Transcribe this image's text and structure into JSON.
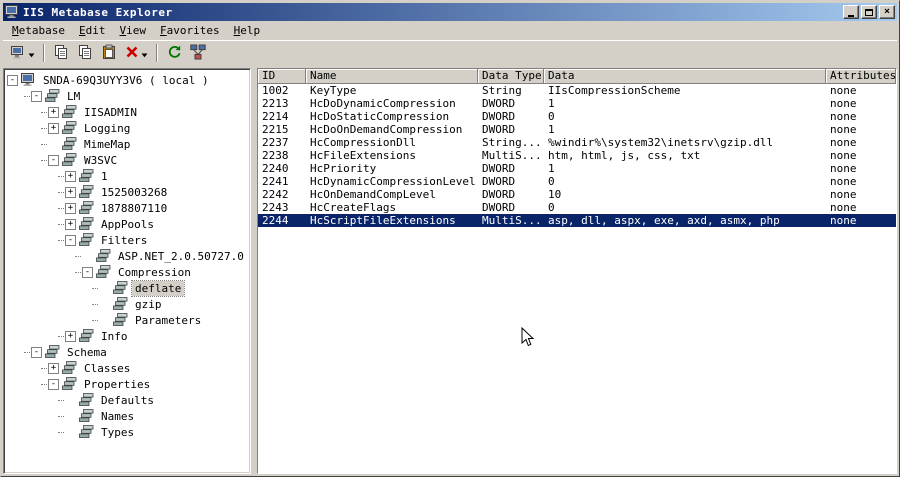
{
  "window": {
    "title": "IIS Metabase Explorer"
  },
  "menu": {
    "items": [
      {
        "label": "Metabase"
      },
      {
        "label": "Edit"
      },
      {
        "label": "View"
      },
      {
        "label": "Favorites"
      },
      {
        "label": "Help"
      }
    ]
  },
  "toolbar": {
    "buttons": [
      {
        "name": "connect-button",
        "icon": "computer-icon",
        "dropdown": true
      },
      {
        "separator": true
      },
      {
        "name": "copy-button",
        "icon": "copy-icon"
      },
      {
        "name": "duplicate-button",
        "icon": "copy-icon"
      },
      {
        "name": "paste-button",
        "icon": "paste-icon"
      },
      {
        "name": "delete-button",
        "icon": "delete-x-icon",
        "dropdown": true
      },
      {
        "separator": true
      },
      {
        "name": "refresh-button",
        "icon": "refresh-icon"
      },
      {
        "name": "network-button",
        "icon": "network-icon"
      }
    ]
  },
  "tree": {
    "items": [
      {
        "depth": 0,
        "expander": "-",
        "icon": "computer",
        "label": "SNDA-69Q3UYY3V6 ( local )"
      },
      {
        "depth": 1,
        "expander": "-",
        "icon": "db",
        "label": "LM"
      },
      {
        "depth": 2,
        "expander": "+",
        "icon": "db",
        "label": "IISADMIN"
      },
      {
        "depth": 2,
        "expander": "+",
        "icon": "db",
        "label": "Logging"
      },
      {
        "depth": 2,
        "expander": "",
        "icon": "db",
        "label": "MimeMap"
      },
      {
        "depth": 2,
        "expander": "-",
        "icon": "db",
        "label": "W3SVC"
      },
      {
        "depth": 3,
        "expander": "+",
        "icon": "db",
        "label": "1"
      },
      {
        "depth": 3,
        "expander": "+",
        "icon": "db",
        "label": "1525003268"
      },
      {
        "depth": 3,
        "expander": "+",
        "icon": "db",
        "label": "1878807110"
      },
      {
        "depth": 3,
        "expander": "+",
        "icon": "db",
        "label": "AppPools"
      },
      {
        "depth": 3,
        "expander": "-",
        "icon": "db",
        "label": "Filters"
      },
      {
        "depth": 4,
        "expander": "",
        "icon": "db",
        "label": "ASP.NET_2.0.50727.0"
      },
      {
        "depth": 4,
        "expander": "-",
        "icon": "db",
        "label": "Compression"
      },
      {
        "depth": 5,
        "expander": "",
        "icon": "db",
        "label": "deflate",
        "selected": true
      },
      {
        "depth": 5,
        "expander": "",
        "icon": "db",
        "label": "gzip"
      },
      {
        "depth": 5,
        "expander": "",
        "icon": "db",
        "label": "Parameters"
      },
      {
        "depth": 3,
        "expander": "+",
        "icon": "db",
        "label": "Info"
      },
      {
        "depth": 1,
        "expander": "-",
        "icon": "db",
        "label": "Schema"
      },
      {
        "depth": 2,
        "expander": "+",
        "icon": "db",
        "label": "Classes"
      },
      {
        "depth": 2,
        "expander": "-",
        "icon": "db",
        "label": "Properties"
      },
      {
        "depth": 3,
        "expander": "",
        "icon": "db",
        "label": "Defaults"
      },
      {
        "depth": 3,
        "expander": "",
        "icon": "db",
        "label": "Names"
      },
      {
        "depth": 3,
        "expander": "",
        "icon": "db",
        "label": "Types"
      }
    ]
  },
  "table": {
    "columns": [
      "ID",
      "Name",
      "Data Type",
      "Data",
      "Attributes"
    ],
    "rows": [
      [
        "1002",
        "KeyType",
        "String",
        "IIsCompressionScheme",
        "none"
      ],
      [
        "2213",
        "HcDoDynamicCompression",
        "DWORD",
        "1",
        "none"
      ],
      [
        "2214",
        "HcDoStaticCompression",
        "DWORD",
        "0",
        "none"
      ],
      [
        "2215",
        "HcDoOnDemandCompression",
        "DWORD",
        "1",
        "none"
      ],
      [
        "2237",
        "HcCompressionDll",
        "String...",
        "%windir%\\system32\\inetsrv\\gzip.dll",
        "none"
      ],
      [
        "2238",
        "HcFileExtensions",
        "MultiS...",
        "htm, html, js, css, txt",
        "none"
      ],
      [
        "2240",
        "HcPriority",
        "DWORD",
        "1",
        "none"
      ],
      [
        "2241",
        "HcDynamicCompressionLevel",
        "DWORD",
        "0",
        "none"
      ],
      [
        "2242",
        "HcOnDemandCompLevel",
        "DWORD",
        "10",
        "none"
      ],
      [
        "2243",
        "HcCreateFlags",
        "DWORD",
        "0",
        "none"
      ],
      [
        "2244",
        "HcScriptFileExtensions",
        "MultiS...",
        "asp, dll, aspx, exe, axd, asmx, php",
        "none"
      ]
    ],
    "selected_row": 10
  },
  "colors": {
    "selection": "#0a246a",
    "chrome": "#d4d0c8",
    "titlebar_start": "#0a246a",
    "titlebar_end": "#a6caf0",
    "tree_inactive_selection": "#d4d0c8",
    "delete_red": "#cc0000",
    "refresh_green": "#007700"
  }
}
